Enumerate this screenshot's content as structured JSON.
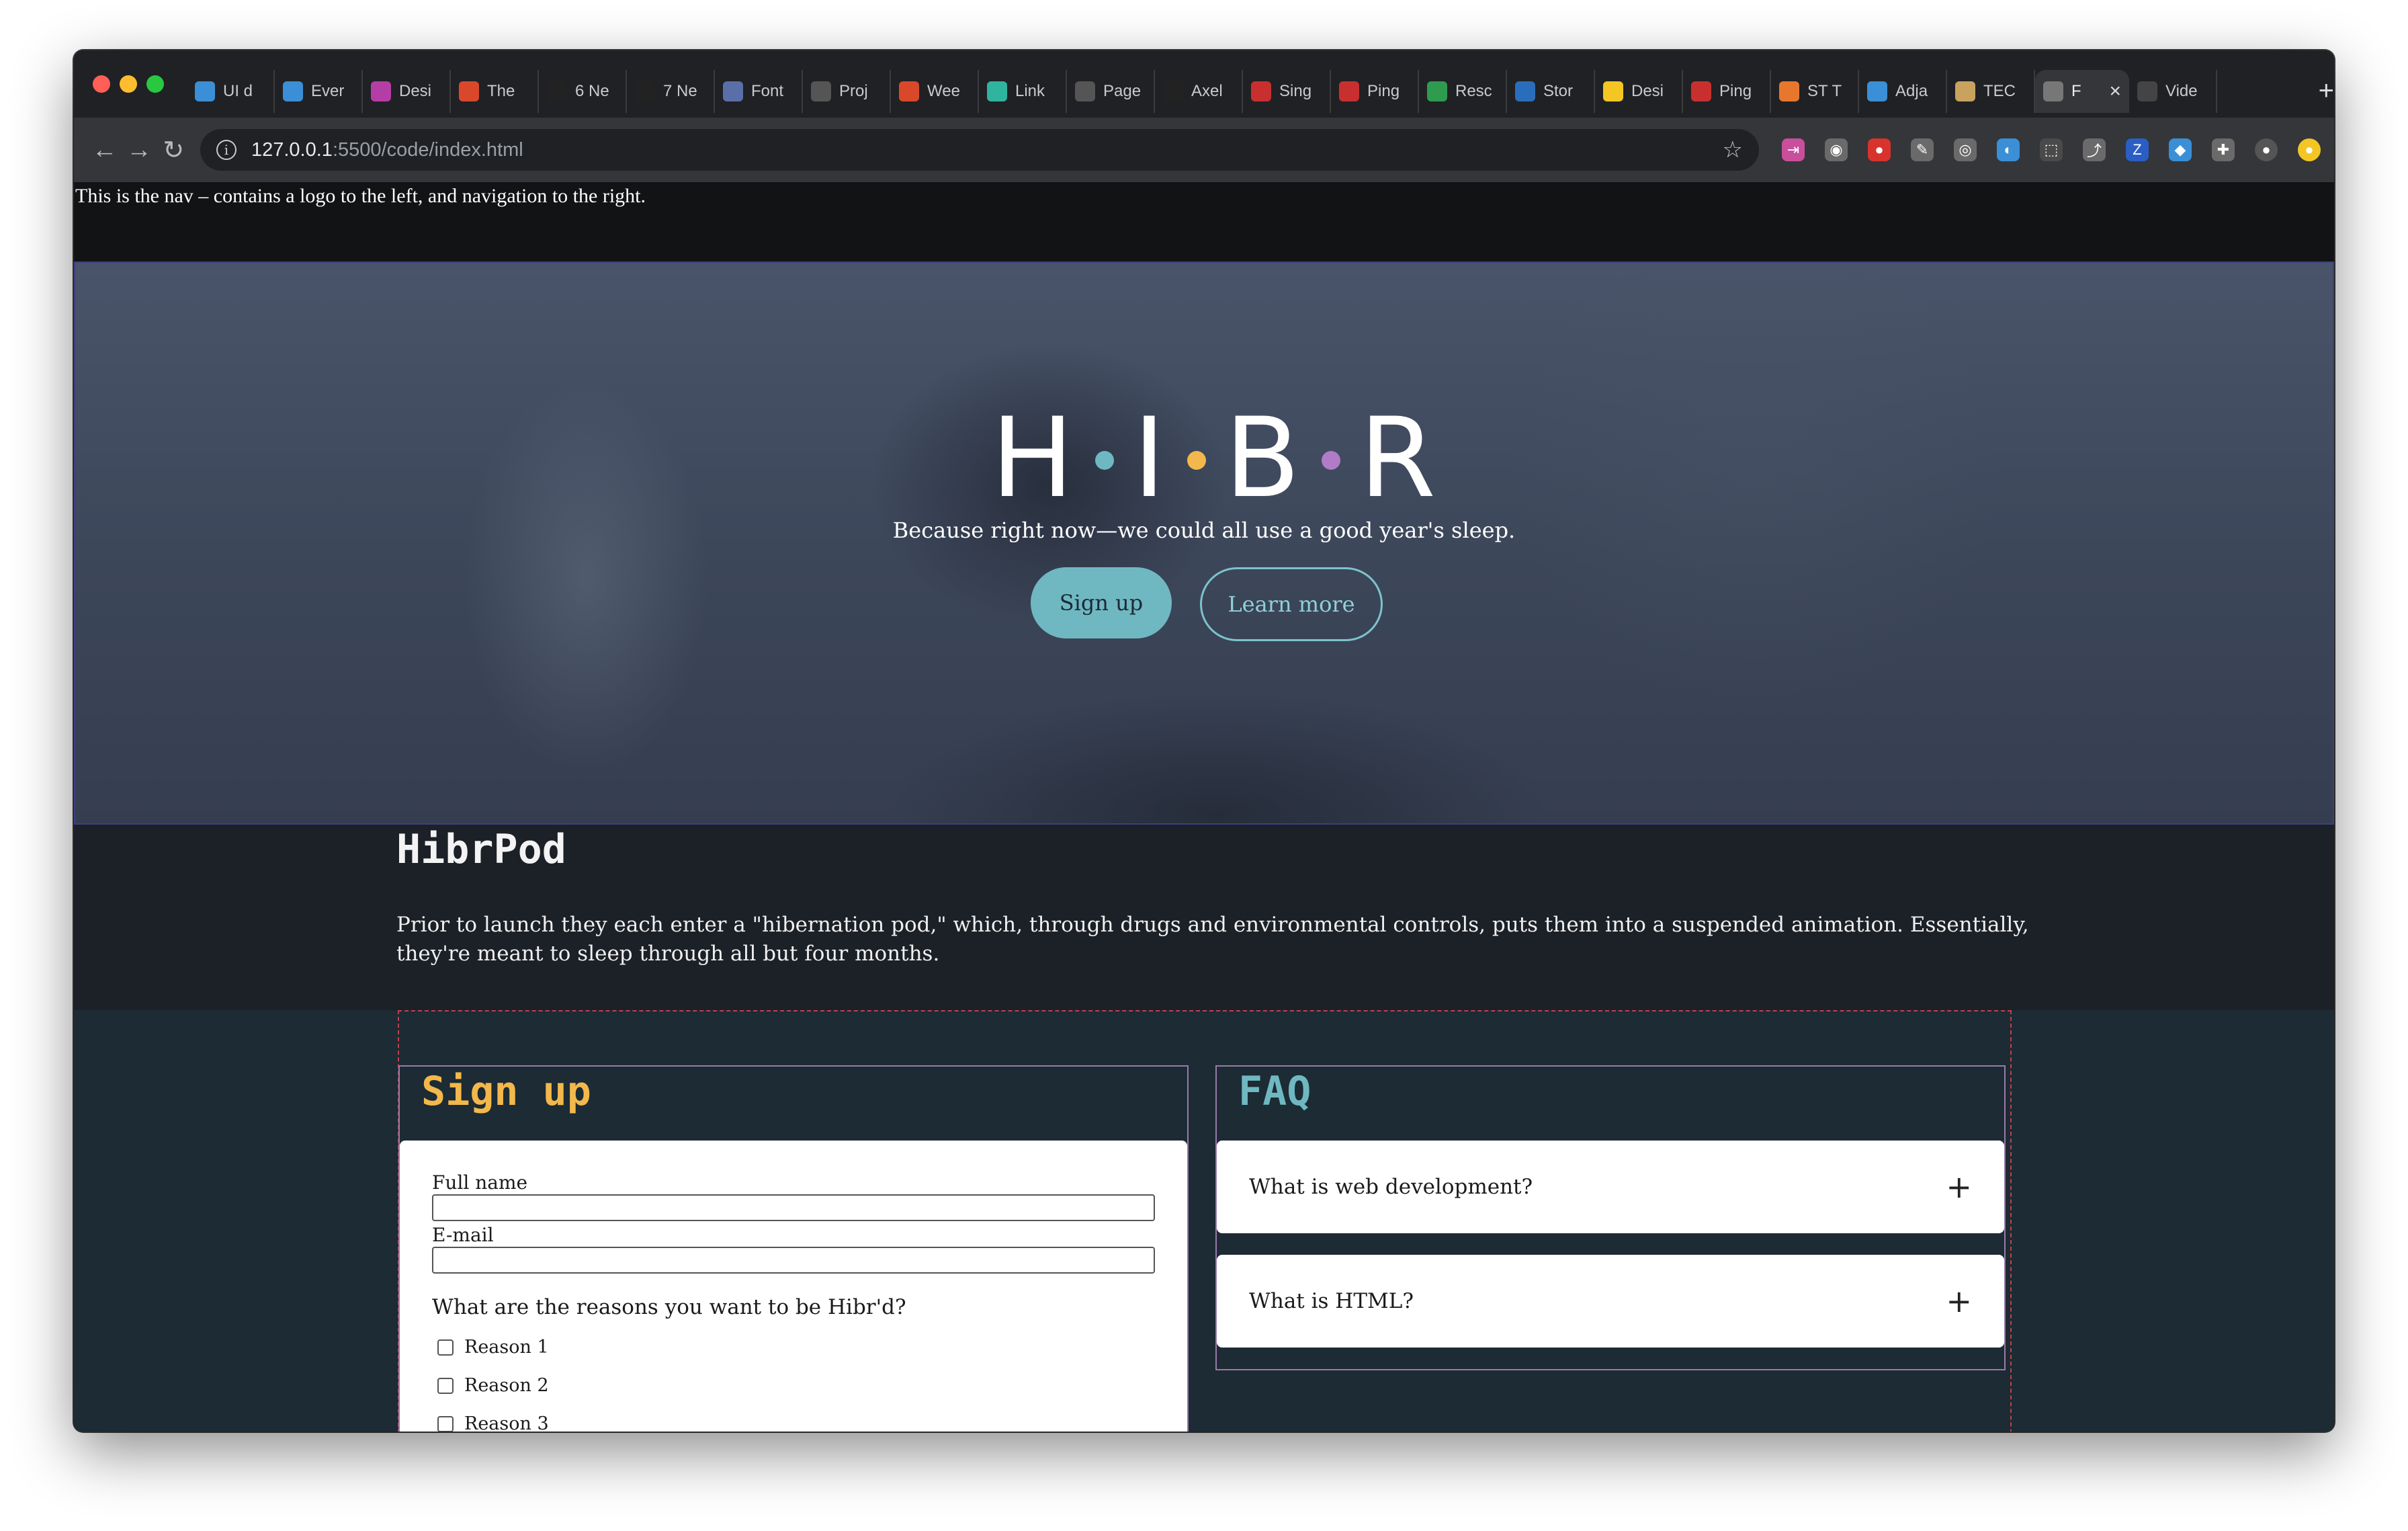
{
  "browser": {
    "tabs": [
      {
        "label": "UI d",
        "icon": "ui-design-icon",
        "color": "#3b8fd6"
      },
      {
        "label": "Ever",
        "icon": "everything-icon",
        "color": "#3b8fd6"
      },
      {
        "label": "Desi",
        "icon": "design-icon",
        "color": "#b53ea6"
      },
      {
        "label": "The",
        "icon": "ux-icon",
        "color": "#d9482b"
      },
      {
        "label": "6 Ne",
        "icon": "medium-icon",
        "color": "#222222"
      },
      {
        "label": "7 Ne",
        "icon": "medium-icon",
        "color": "#222222"
      },
      {
        "label": "Font",
        "icon": "font-icon",
        "color": "#5a6ea8"
      },
      {
        "label": "Proj",
        "icon": "globe-icon",
        "color": "#555555"
      },
      {
        "label": "Wee",
        "icon": "gear-icon",
        "color": "#d9482b"
      },
      {
        "label": "Link",
        "icon": "diamond-icon",
        "color": "#2fb4a0"
      },
      {
        "label": "Page",
        "icon": "globe-icon",
        "color": "#555555"
      },
      {
        "label": "Axel",
        "icon": "github-icon",
        "color": "#222222"
      },
      {
        "label": "Sing",
        "icon": "premiere-icon",
        "color": "#c8302f"
      },
      {
        "label": "Ping",
        "icon": "premiere-icon",
        "color": "#c8302f"
      },
      {
        "label": "Resc",
        "icon": "drive-icon",
        "color": "#2f9b4f"
      },
      {
        "label": "Stor",
        "icon": "trello-icon",
        "color": "#2a6ebb"
      },
      {
        "label": "Desi",
        "icon": "miro-icon",
        "color": "#f3c623"
      },
      {
        "label": "Ping",
        "icon": "premiere-icon",
        "color": "#c8302f"
      },
      {
        "label": "ST T",
        "icon": "tools-icon",
        "color": "#e8772e"
      },
      {
        "label": "Adja",
        "icon": "adjacent-icon",
        "color": "#3b8fd6"
      },
      {
        "label": "TEC",
        "icon": "tec-icon",
        "color": "#c9a25f"
      },
      {
        "label": "F",
        "icon": "globe-icon",
        "color": "#777777",
        "active": true
      },
      {
        "label": "Vide",
        "icon": "video-icon",
        "color": "#444444"
      }
    ],
    "new_tab": "+",
    "url_host": "127.0.0.1",
    "url_path": ":5500/code/index.html",
    "info_glyph": "i",
    "star": "☆",
    "back": "←",
    "forward": "→",
    "reload": "↻",
    "extensions": [
      {
        "icon": "share-arrow-icon",
        "color": "#c94f9d",
        "glyph": "⇥"
      },
      {
        "icon": "camera-icon",
        "color": "#6a6a6a",
        "glyph": "◉"
      },
      {
        "icon": "shield-icon",
        "color": "#d8332c",
        "glyph": "●"
      },
      {
        "icon": "pen-icon",
        "color": "#6a6a6a",
        "glyph": "✎"
      },
      {
        "icon": "search-icon",
        "color": "#6a6a6a",
        "glyph": "◎"
      },
      {
        "icon": "font-ninja-icon",
        "color": "#3b8fd6",
        "glyph": "◐"
      },
      {
        "icon": "screenshot-icon",
        "color": "#4a4a4a",
        "glyph": "⬚"
      },
      {
        "icon": "share-icon",
        "color": "#6a6a6a",
        "glyph": "⤴"
      },
      {
        "icon": "zip-icon",
        "color": "#2a5ec4",
        "glyph": "Z"
      },
      {
        "icon": "gem-icon",
        "color": "#3b8fd6",
        "glyph": "◆"
      },
      {
        "icon": "puzzle-icon",
        "color": "#6a6a6a",
        "glyph": "✚"
      },
      {
        "icon": "profile-avatar-icon",
        "color": "#555555",
        "glyph": "●"
      },
      {
        "icon": "update-icon",
        "color": "#f3c623",
        "glyph": "●"
      }
    ]
  },
  "page": {
    "nav_text": "This is the nav – contains a logo to the left, and navigation to the right.",
    "hero": {
      "logo_letters": [
        "H",
        "I",
        "B",
        "R"
      ],
      "dot_colors": [
        "#6fb8c2",
        "#f2b84b",
        "#b07cc6"
      ],
      "tagline": "Because right now—we could all use a good year's sleep.",
      "primary_cta": "Sign up",
      "secondary_cta": "Learn more"
    },
    "hibrpod": {
      "title": "HibrPod",
      "body": "Prior to launch they each enter a \"hibernation pod,\" which, through drugs and environmental controls, puts them into a suspended animation. Essentially, they're meant to sleep through all but four months."
    },
    "signup": {
      "title": "Sign up",
      "full_name_label": "Full name",
      "email_label": "E-mail",
      "question": "What are the reasons you want to be Hibr'd?",
      "reasons": [
        "Reason 1",
        "Reason 2",
        "Reason 3"
      ]
    },
    "faq": {
      "title": "FAQ",
      "items": [
        {
          "question": "What is web development?",
          "toggle": "+"
        },
        {
          "question": "What is HTML?",
          "toggle": "+"
        }
      ]
    }
  }
}
